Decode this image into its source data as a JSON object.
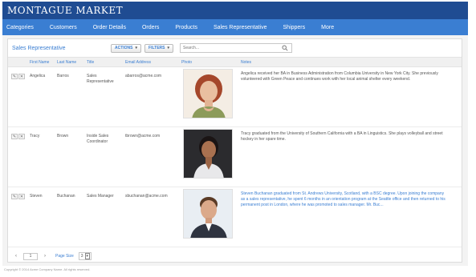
{
  "app": {
    "brand": "MONTAGUE MARKET"
  },
  "nav": [
    "Categories",
    "Customers",
    "Order Details",
    "Orders",
    "Products",
    "Sales Representative",
    "Shippers",
    "More"
  ],
  "section": {
    "title": "Sales Representative"
  },
  "toolbar": {
    "actions_label": "ACTIONS",
    "filters_label": "FILTERS",
    "search_placeholder": "Search..."
  },
  "columns": [
    "First Name",
    "Last Name",
    "Title",
    "Email Address",
    "Photo",
    "Notes"
  ],
  "rows": [
    {
      "first": "Angelica",
      "last": "Barros",
      "title": "Sales Representative",
      "email": "abarros@acme.com",
      "photo_icon": "person-photo-woman-red-hair",
      "notes": "Angelica received her BA in Business Administration from Columbia University in New York City. She previously volunteered with Green Peace and continues work with her local animal shelter every weekend."
    },
    {
      "first": "Tracy",
      "last": "Brown",
      "title": "Inside Sales Coordinator",
      "email": "tbrown@acme.com",
      "photo_icon": "person-photo-woman-dark-hair",
      "notes": "Tracy graduated from the University of Southern California with a BA in Linguistics. She plays volleyball and street hockey in her spare time."
    },
    {
      "first": "Steven",
      "last": "Buchanan",
      "title": "Sales Manager",
      "email": "sbuchanan@acme.com",
      "photo_icon": "person-photo-man",
      "notes": "Steven Buchanan graduated from St. Andrews University, Scotland, with a BSC degree. Upon joining the company as a sales representative, he spent 6 months in an orientation program at the Seattle office and then returned to his permanent post in London, where he was promoted to sales manager. Mr. Buc..."
    }
  ],
  "pager": {
    "page": "1",
    "page_size_label": "Page Size",
    "page_size": "3"
  },
  "footer": {
    "text": "Copyright © 2014 Acme Company Name. All rights reserved."
  },
  "colors": {
    "title_bar": "#1f4c92",
    "nav_bar": "#3a7ed2",
    "accent": "#3a7ed2"
  }
}
